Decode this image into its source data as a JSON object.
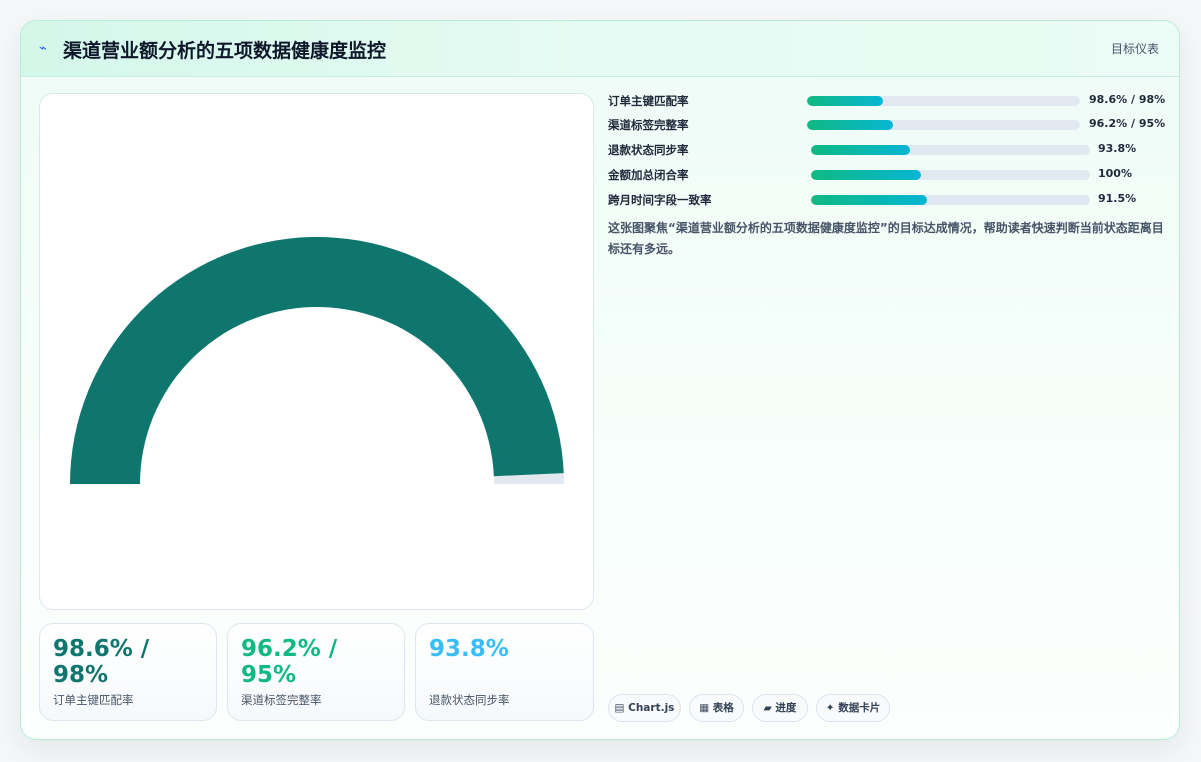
{
  "header": {
    "title_icon": "⌁",
    "title": "渠道营业额分析的五项数据健康度监控",
    "tag": "目标仪表"
  },
  "colors": {
    "gauge_fill": "#0f766e",
    "gauge_track": "#e2e8f0",
    "kpi_1": "#0f766e",
    "kpi_2": "#10b981",
    "kpi_3": "#38bdf8"
  },
  "chart_data": {
    "type": "gauge",
    "value": 98.6,
    "max": 100,
    "target": 98,
    "metrics": [
      {
        "name": "订单主键匹配率",
        "value": 98.6,
        "target": 98,
        "label": "98.6% / 98%"
      },
      {
        "name": "渠道标签完整率",
        "value": 96.2,
        "target": 95,
        "label": "96.2% / 95%"
      },
      {
        "name": "退款状态同步率",
        "value": 93.8,
        "target": null,
        "label": "93.8%"
      },
      {
        "name": "金额加总闭合率",
        "value": 100,
        "target": null,
        "label": "100%"
      },
      {
        "name": "跨月时间字段一致率",
        "value": 91.5,
        "target": null,
        "label": "91.5%"
      }
    ]
  },
  "progress": [
    {
      "name": "订单主键匹配率",
      "label": "98.6% / 98%",
      "fraction": 0.28
    },
    {
      "name": "渠道标签完整率",
      "label": "96.2% / 95%",
      "fraction": 0.315
    },
    {
      "name": "退款状态同步率",
      "label": "93.8%",
      "fraction": 0.355
    },
    {
      "name": "金额加总闭合率",
      "label": "100%",
      "fraction": 0.395
    },
    {
      "name": "跨月时间字段一致率",
      "label": "91.5%",
      "fraction": 0.415
    }
  ],
  "kpis": [
    {
      "value": "98.6% / 98%",
      "label": "订单主键匹配率"
    },
    {
      "value": "96.2% / 95%",
      "label": "渠道标签完整率"
    },
    {
      "value": "93.8%",
      "label": "退款状态同步率"
    }
  ],
  "description": "这张图聚焦“渠道营业额分析的五项数据健康度监控”的目标达成情况，帮助读者快速判断当前状态距离目标还有多远。",
  "chips": [
    {
      "icon": "chart-icon",
      "glyph": "▤",
      "label": "Chart.js"
    },
    {
      "icon": "table-icon",
      "glyph": "▦",
      "label": "表格"
    },
    {
      "icon": "progress-icon",
      "glyph": "▰",
      "label": "进度"
    },
    {
      "icon": "sparkle-icon",
      "glyph": "✦",
      "label": "数据卡片"
    }
  ]
}
